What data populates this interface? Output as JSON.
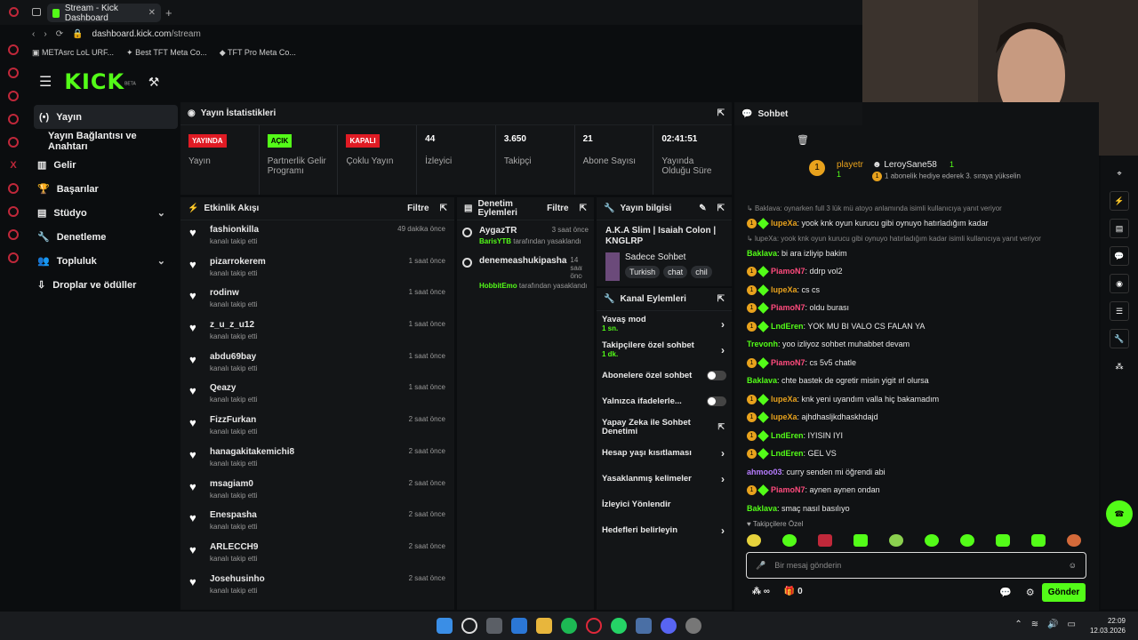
{
  "browser": {
    "tab_title": "Stream - Kick Dashboard",
    "url_domain": "dashboard.kick.com",
    "url_path": "/stream",
    "bookmarks": [
      "METAsrc LoL URF...",
      "Best TFT Meta Co...",
      "TFT Pro Meta Co..."
    ]
  },
  "brand": {
    "logo": "KICK",
    "beta": "BETA"
  },
  "nav": [
    {
      "label": "Yayın"
    },
    {
      "label": "Yayın Bağlantısı ve Anahtarı"
    },
    {
      "label": "Gelir"
    },
    {
      "label": "Başarılar"
    },
    {
      "label": "Stüdyo"
    },
    {
      "label": "Denetleme"
    },
    {
      "label": "Topluluk"
    },
    {
      "label": "Droplar ve ödüller"
    }
  ],
  "stats": {
    "title": "Yayın İstatistikleri",
    "items": [
      {
        "badge": "YAYINDA",
        "badge_color": "#e01b24",
        "label": "Yayın"
      },
      {
        "badge": "AÇIK",
        "badge_color": "#53fc18",
        "label": "Partnerlik Gelir Programı"
      },
      {
        "badge": "KAPALI",
        "badge_color": "#e01b24",
        "label": "Çoklu Yayın"
      },
      {
        "value": "44",
        "label": "İzleyici"
      },
      {
        "value": "3.650",
        "label": "Takipçi"
      },
      {
        "value": "21",
        "label": "Abone Sayısı"
      },
      {
        "value": "02:41:51",
        "label": "Yayında Olduğu Süre"
      }
    ]
  },
  "activity": {
    "title": "Etkinlik Akışı",
    "filter": "Filtre",
    "items": [
      {
        "name": "fashionkilla",
        "sub": "kanalı takip etti",
        "time": "49 dakika önce"
      },
      {
        "name": "pizarrokerem",
        "sub": "kanalı takip etti",
        "time": "1 saat önce"
      },
      {
        "name": "rodinw",
        "sub": "kanalı takip etti",
        "time": "1 saat önce"
      },
      {
        "name": "z_u_z_u12",
        "sub": "kanalı takip etti",
        "time": "1 saat önce"
      },
      {
        "name": "abdu69bay",
        "sub": "kanalı takip etti",
        "time": "1 saat önce"
      },
      {
        "name": "Qeazy",
        "sub": "kanalı takip etti",
        "time": "1 saat önce"
      },
      {
        "name": "FizzFurkan",
        "sub": "kanalı takip etti",
        "time": "2 saat önce"
      },
      {
        "name": "hanagakitakemichi8",
        "sub": "kanalı takip etti",
        "time": "2 saat önce"
      },
      {
        "name": "msagiam0",
        "sub": "kanalı takip etti",
        "time": "2 saat önce"
      },
      {
        "name": "Enespasha",
        "sub": "kanalı takip etti",
        "time": "2 saat önce"
      },
      {
        "name": "ARLECCH9",
        "sub": "kanalı takip etti",
        "time": "2 saat önce"
      },
      {
        "name": "Josehusinho",
        "sub": "kanalı takip etti",
        "time": "2 saat önce"
      }
    ]
  },
  "moderation": {
    "title": "Denetim Eylemleri",
    "filter": "Filtre",
    "items": [
      {
        "user": "AygazTR",
        "time": "3 saat önce",
        "by": "BarisYTB",
        "suffix": "tarafından yasaklandı"
      },
      {
        "user": "denemeashukipasha",
        "time": "14 saat önce",
        "by": "HobbitEmo",
        "suffix": "tarafından yasaklandı"
      }
    ]
  },
  "streaminfo": {
    "title": "Yayın bilgisi",
    "stream_title": "A.K.A Slim | Isaiah Colon | KNGLRP",
    "category": "Sadece Sohbet",
    "tags": [
      "Turkish",
      "chat",
      "chil"
    ]
  },
  "channel_actions": {
    "title": "Kanal Eylemleri",
    "items": [
      {
        "label": "Yavaş mod",
        "sub": "1 sn.",
        "control": "arrow"
      },
      {
        "label": "Takipçilere özel sohbet",
        "sub": "1 dk.",
        "control": "arrow"
      },
      {
        "label": "Abonelere özel sohbet",
        "control": "toggle"
      },
      {
        "label": "Yalnızca ifadelerle...",
        "control": "toggle"
      },
      {
        "label": "Yapay Zeka ile Sohbet Denetimi",
        "control": "ext"
      },
      {
        "label": "Hesap yaşı kısıtlaması",
        "control": "arrow"
      },
      {
        "label": "Yasaklanmış kelimeler",
        "control": "arrow"
      },
      {
        "label": "İzleyici Yönlendir",
        "control": "none"
      },
      {
        "label": "Hedefleri belirleyin",
        "control": "arrow"
      }
    ]
  },
  "chat": {
    "title": "Sohbet",
    "pinned_user1": "playetr",
    "pinned_count1": "1",
    "pinned_user2": "LeroySane58",
    "pinned_count2": "1",
    "pinned_text": "1 abonelik hediye ederek 3. sıraya yükselin",
    "messages": [
      {
        "reply": "Baklava: oynarken full 3 lük mü atoyo anlamında isimli kullanıcıya yanıt veriyor"
      },
      {
        "user": "lupeXa",
        "color": "#e8a21d",
        "badges": true,
        "text": "yook knk oyun kurucu gibi oynuyo hatırladığım kadar"
      },
      {
        "reply": "lupeXa: yook knk oyun kurucu gibi oynuyo hatırladığım kadar isimli kullanıcıya yanıt veriyor"
      },
      {
        "user": "Baklava",
        "color": "#53fc18",
        "badges": false,
        "text": "bi ara izliyip bakim"
      },
      {
        "user": "PiamoN7",
        "color": "#ff4b7d",
        "badges": true,
        "text": "ddrp vol2"
      },
      {
        "user": "lupeXa",
        "color": "#e8a21d",
        "badges": true,
        "text": "cs cs"
      },
      {
        "user": "PiamoN7",
        "color": "#ff4b7d",
        "badges": true,
        "text": "oldu burası"
      },
      {
        "user": "LndEren",
        "color": "#53fc18",
        "badges": true,
        "text": "YOK MU BI VALO CS FALAN YA"
      },
      {
        "user": "Trevonh",
        "color": "#53fc18",
        "badges": false,
        "text": "yoo izliyoz sohbet muhabbet devam"
      },
      {
        "user": "PiamoN7",
        "color": "#ff4b7d",
        "badges": true,
        "text": "cs 5v5 chatle"
      },
      {
        "user": "Baklava",
        "color": "#53fc18",
        "badges": false,
        "text": "chte bastek de ogretir misin yigit ırl olursa"
      },
      {
        "user": "lupeXa",
        "color": "#e8a21d",
        "badges": true,
        "text": "knk yeni uyandım valla hiç bakamadım"
      },
      {
        "user": "lupeXa",
        "color": "#e8a21d",
        "badges": true,
        "text": "ajhdhasljkdhaskhdajd"
      },
      {
        "user": "LndEren",
        "color": "#53fc18",
        "badges": true,
        "text": "IYISIN IYI"
      },
      {
        "user": "LndEren",
        "color": "#53fc18",
        "badges": true,
        "text": "GEL VS"
      },
      {
        "user": "ahmoo03",
        "color": "#b77cff",
        "badges": false,
        "text": "curry senden mi öğrendi abi"
      },
      {
        "user": "PiamoN7",
        "color": "#ff4b7d",
        "badges": true,
        "text": "aynen aynen ondan"
      },
      {
        "user": "Baklava",
        "color": "#53fc18",
        "badges": false,
        "text": "smaç nasıl basılıyo"
      }
    ],
    "emote_label": "Takipçilere Özel",
    "placeholder": "Bir mesaj gönderin",
    "counter": "0",
    "send": "Gönder"
  },
  "clock": {
    "time": "22:09",
    "date": "12.03.2026"
  }
}
